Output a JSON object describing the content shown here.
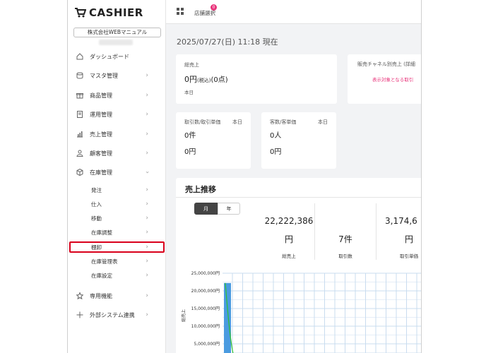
{
  "brand": {
    "name": "CASHIER",
    "company": "株式会社WEBマニュアル"
  },
  "sidebar": {
    "items": [
      {
        "label": "ダッシュボード",
        "icon": "home-icon"
      },
      {
        "label": "マスタ管理",
        "icon": "database-icon"
      },
      {
        "label": "商品管理",
        "icon": "gift-icon"
      },
      {
        "label": "運用管理",
        "icon": "document-icon"
      },
      {
        "label": "売上管理",
        "icon": "bar-chart-icon"
      },
      {
        "label": "顧客管理",
        "icon": "user-icon"
      },
      {
        "label": "在庫管理",
        "icon": "box-icon"
      }
    ],
    "inventory_sub": [
      {
        "label": "発注"
      },
      {
        "label": "仕入"
      },
      {
        "label": "移動"
      },
      {
        "label": "在庫調整"
      },
      {
        "label": "棚卸"
      },
      {
        "label": "在庫管理表"
      },
      {
        "label": "在庫設定"
      }
    ],
    "bottom": [
      {
        "label": "専用機能",
        "icon": "star-icon"
      },
      {
        "label": "外部システム連携",
        "icon": "plus-icon"
      }
    ]
  },
  "topbar": {
    "store_select": "店舗選択",
    "badge": "0"
  },
  "datetime": "2025/07/27(日) 11:18 現在",
  "total_sales": {
    "label": "総売上",
    "value": "0円",
    "tax": "(税込)",
    "count": "(0点)",
    "period": "本日"
  },
  "channel_sales": {
    "label": "販売チャネル別売上 (詳細",
    "notice": "表示対象となる取引"
  },
  "transactions": {
    "label": "取引数/取引単価",
    "period": "本日",
    "count": "0件",
    "unit_price": "0円"
  },
  "customers": {
    "label": "客数/客単価",
    "period": "本日",
    "count": "0人",
    "unit_price": "0円"
  },
  "sales_trend": {
    "title": "売上推移",
    "toggle_month": "月",
    "toggle_year": "年",
    "stats": [
      {
        "value": "22,222,386",
        "unit": "円",
        "label": "総売上"
      },
      {
        "value": "7件",
        "unit": "",
        "label": "取引数"
      },
      {
        "value": "3,174,6",
        "unit": "円",
        "label": "取引単価"
      }
    ]
  },
  "chart_data": {
    "type": "bar",
    "ylabel": "総売上",
    "yticks": [
      "25,000,000円",
      "20,000,000円",
      "15,000,000円",
      "10,000,000円",
      "5,000,000円"
    ],
    "ylim": [
      0,
      25000000
    ],
    "bar_color": "#4a9be0",
    "line_color": "#2fc22f",
    "series": [
      {
        "values": [
          22222386
        ]
      }
    ]
  }
}
